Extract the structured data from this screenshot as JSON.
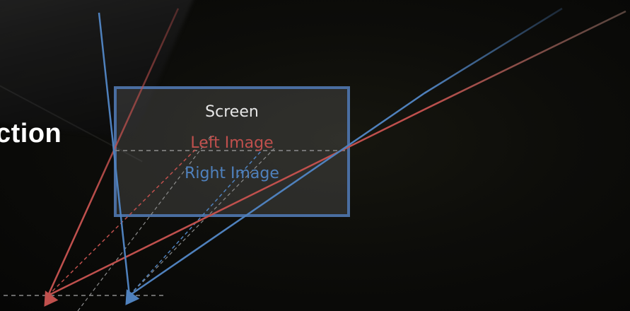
{
  "slide": {
    "partial_heading": "ction"
  },
  "screen": {
    "label": "Screen",
    "left_image_label": "Left Image",
    "right_image_label": "Right Image"
  },
  "colors": {
    "left": "#c0504d",
    "right": "#4f81bd",
    "screen_border": "#4a6ea1",
    "screen_label": "#e6e6e6",
    "dashed": "#8c8c8c"
  }
}
